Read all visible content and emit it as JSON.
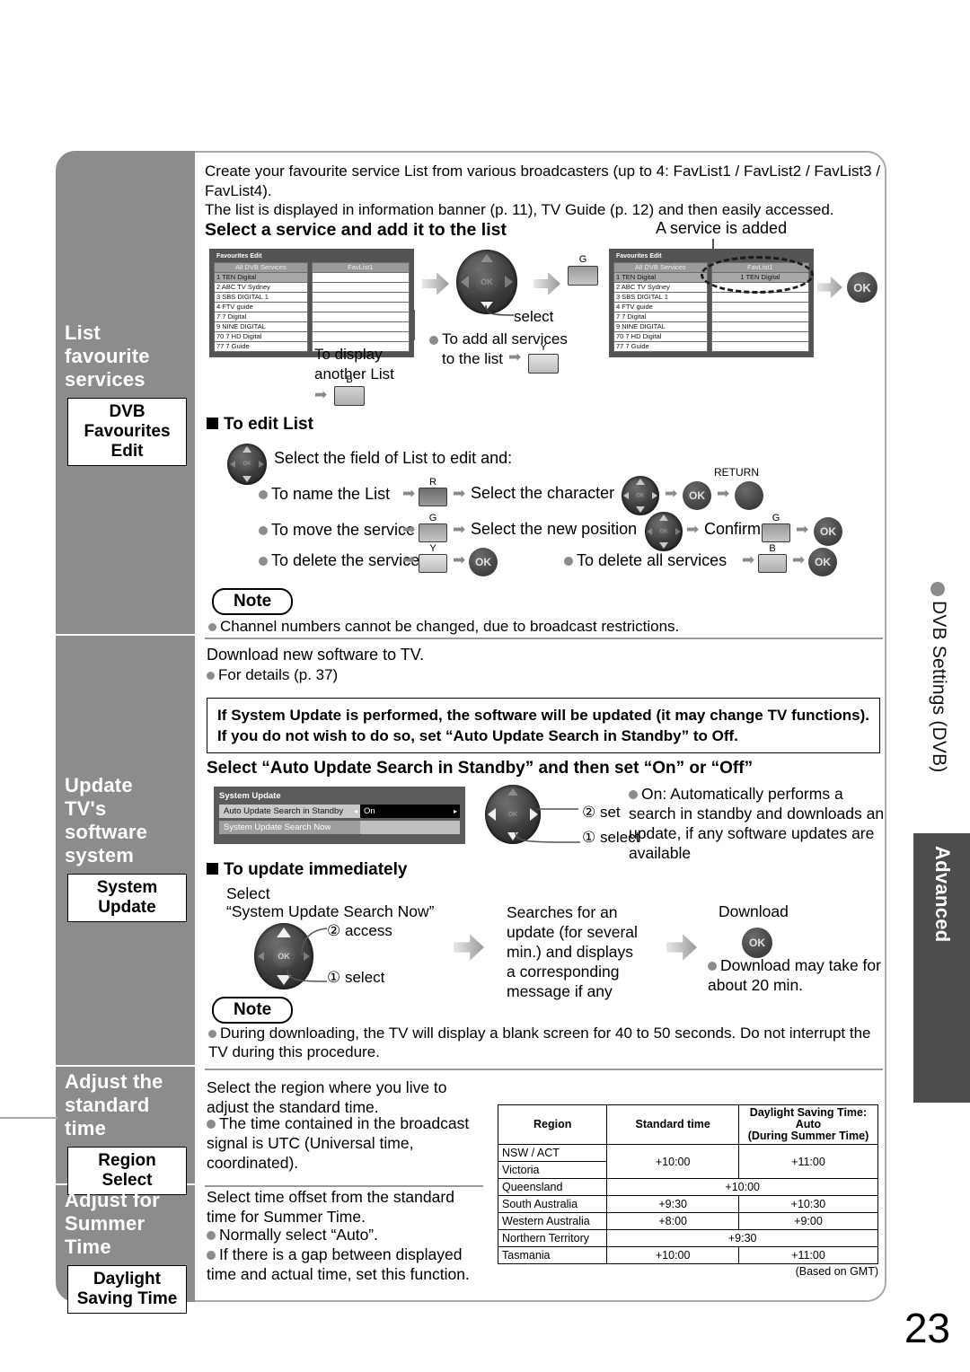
{
  "page": {
    "number": "23"
  },
  "right_tabs": {
    "dvb_settings": "DVB Settings (DVB)",
    "advanced": "Advanced"
  },
  "sections": [
    {
      "sidebar": {
        "title": "List\nfavourite\nservices",
        "chip": "DVB\nFavourites\nEdit"
      },
      "intro": [
        "Create your favourite service List from various broadcasters (up to 4: FavList1 / FavList2 / FavList3 / FavList4).",
        "The list is displayed in information banner (p. 11), TV Guide (p. 12) and then easily accessed."
      ],
      "heading": "Select a service and add it to the list",
      "added_caption": "A service is added",
      "tv_screen": {
        "title": "Favourites Edit",
        "col_left": "All DVB Services",
        "col_right": "FavList1",
        "rows": [
          {
            "num": "1",
            "name": "TEN Digital"
          },
          {
            "num": "2",
            "name": "ABC TV Sydney"
          },
          {
            "num": "3",
            "name": "SBS DIGITAL 1"
          },
          {
            "num": "4",
            "name": "FTV guide"
          },
          {
            "num": "7",
            "name": "7 Digital"
          },
          {
            "num": "9",
            "name": "NINE DIGITAL"
          },
          {
            "num": "70",
            "name": "7 HD Digital"
          },
          {
            "num": "77",
            "name": "7 Guide"
          }
        ],
        "added_entry": "1  TEN Digital"
      },
      "labels": {
        "select": "select",
        "to_display_another_list": "To display\nanother List",
        "add_all_1": "To add all services",
        "add_all_2": "to the list",
        "btn_b": "B",
        "btn_y": "Y",
        "btn_g": "G",
        "ok": "OK"
      },
      "edit_list": {
        "heading": "To edit List",
        "lead": "Select the field of List to edit and:",
        "rows": [
          {
            "label": "To name the List",
            "btn": "R",
            "mid": "Select the character",
            "ok": "OK",
            "ret": "RETURN"
          },
          {
            "label": "To move the service",
            "btn": "G",
            "mid": "Select the new position",
            "confirm": "Confirm",
            "btn2": "G",
            "ok": "OK"
          },
          {
            "label": "To delete the service",
            "btn": "Y",
            "ok": "OK"
          },
          {
            "label": "To delete all services",
            "btn": "B",
            "ok": "OK"
          }
        ]
      },
      "note": {
        "title": "Note",
        "items": [
          "Channel numbers cannot be changed, due to broadcast restrictions."
        ]
      }
    },
    {
      "sidebar": {
        "title": "Update\nTV's\nsoftware\nsystem",
        "chip": "System\nUpdate"
      },
      "intro": [
        "Download new software to TV."
      ],
      "intro_bullet": "For details (p. 37)",
      "warning": "If System Update is performed, the software will be updated (it may change TV functions). If you do not wish to do so, set “Auto Update Search in Standby” to Off.",
      "heading": "Select “Auto Update Search in Standby” and then set “On” or “Off”",
      "sys_menu": {
        "title": "System Update",
        "rows": [
          {
            "label": "Auto Update Search in Standby",
            "value": "On"
          },
          {
            "label": "System Update Search Now",
            "value": ""
          }
        ]
      },
      "steps": {
        "set": "② set",
        "select": "① select"
      },
      "on_desc": "On: Automatically performs a search in standby and downloads an update, if any software updates are available",
      "update_now": {
        "heading": "To update immediately",
        "select_label": "Select",
        "select_target": "“System Update Search Now”",
        "access": "② access",
        "select": "① select",
        "searching": "Searches for an update (for several min.) and displays a corresponding message if any",
        "download": "Download",
        "ok": "OK",
        "download_note": "Download may take for about 20 min."
      },
      "note": {
        "title": "Note",
        "items": [
          "During downloading, the TV will display a blank screen for 40 to 50 seconds. Do not interrupt the TV during this procedure."
        ]
      }
    },
    {
      "sidebar": {
        "title": "Adjust the\nstandard time",
        "chip": "Region\nSelect"
      },
      "intro": [
        "Select the region where you live to adjust the standard time."
      ],
      "bullets": [
        "The time contained in the broadcast signal is UTC (Universal time, coordinated)."
      ]
    },
    {
      "sidebar": {
        "title": "Adjust for\nSummer Time",
        "chip": "Daylight\nSaving Time"
      },
      "intro": [
        "Select time offset from the standard time for Summer Time."
      ],
      "bullets": [
        "Normally select “Auto”.",
        "If there is a gap between displayed time and actual time, set this function."
      ]
    }
  ],
  "region_table": {
    "headers": [
      "Region",
      "Standard time",
      "Daylight Saving Time: Auto\n(During Summer Time)"
    ],
    "header_dst_line1": "Daylight Saving Time: Auto",
    "header_dst_line2": "(During Summer Time)",
    "rows": [
      {
        "region": "NSW / ACT",
        "standard": "+10:00",
        "dst": "+11:00"
      },
      {
        "region": "Victoria",
        "standard": "",
        "dst": ""
      },
      {
        "region": "Queensland",
        "span": "+10:00"
      },
      {
        "region": "South Australia",
        "standard": "+9:30",
        "dst": "+10:30"
      },
      {
        "region": "Western Australia",
        "standard": "+8:00",
        "dst": "+9:00"
      },
      {
        "region": "Northern Territory",
        "span": "+9:30"
      },
      {
        "region": "Tasmania",
        "standard": "+10:00",
        "dst": "+11:00"
      }
    ],
    "footnote": "(Based on GMT)"
  }
}
